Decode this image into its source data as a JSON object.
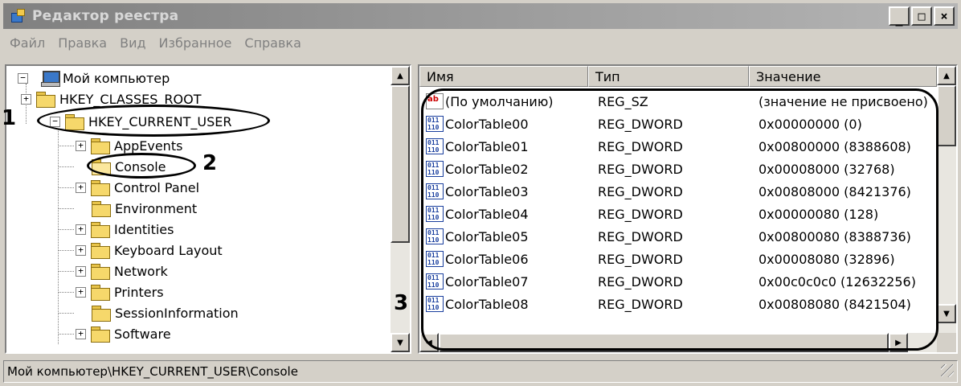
{
  "window": {
    "title": "Редактор реестра",
    "buttons": {
      "minimize": "_",
      "maximize": "□",
      "close": "×"
    }
  },
  "menu": [
    "Файл",
    "Правка",
    "Вид",
    "Избранное",
    "Справка"
  ],
  "tree": {
    "root": "Мой компьютер",
    "hkcr": "HKEY_CLASSES_ROOT",
    "hkcu": "HKEY_CURRENT_USER",
    "children": [
      "AppEvents",
      "Console",
      "Control Panel",
      "Environment",
      "Identities",
      "Keyboard Layout",
      "Network",
      "Printers",
      "SessionInformation",
      "Software"
    ]
  },
  "list": {
    "columns": {
      "name": "Имя",
      "type": "Тип",
      "value": "Значение"
    },
    "rows": [
      {
        "name": "(По умолчанию)",
        "type": "REG_SZ",
        "value": "(значение не присвоено)",
        "icon": "string-value-icon"
      },
      {
        "name": "ColorTable00",
        "type": "REG_DWORD",
        "value": "0x00000000 (0)",
        "icon": "dword-value-icon"
      },
      {
        "name": "ColorTable01",
        "type": "REG_DWORD",
        "value": "0x00800000 (8388608)",
        "icon": "dword-value-icon"
      },
      {
        "name": "ColorTable02",
        "type": "REG_DWORD",
        "value": "0x00008000 (32768)",
        "icon": "dword-value-icon"
      },
      {
        "name": "ColorTable03",
        "type": "REG_DWORD",
        "value": "0x00808000 (8421376)",
        "icon": "dword-value-icon"
      },
      {
        "name": "ColorTable04",
        "type": "REG_DWORD",
        "value": "0x00000080 (128)",
        "icon": "dword-value-icon"
      },
      {
        "name": "ColorTable05",
        "type": "REG_DWORD",
        "value": "0x00800080 (8388736)",
        "icon": "dword-value-icon"
      },
      {
        "name": "ColorTable06",
        "type": "REG_DWORD",
        "value": "0x00008080 (32896)",
        "icon": "dword-value-icon"
      },
      {
        "name": "ColorTable07",
        "type": "REG_DWORD",
        "value": "0x00c0c0c0 (12632256)",
        "icon": "dword-value-icon"
      },
      {
        "name": "ColorTable08",
        "type": "REG_DWORD",
        "value": "0x00808080 (8421504)",
        "icon": "dword-value-icon"
      }
    ]
  },
  "status": "Мой компьютер\\HKEY_CURRENT_USER\\Console",
  "annotations": {
    "one": "1",
    "two": "2",
    "three": "3"
  }
}
